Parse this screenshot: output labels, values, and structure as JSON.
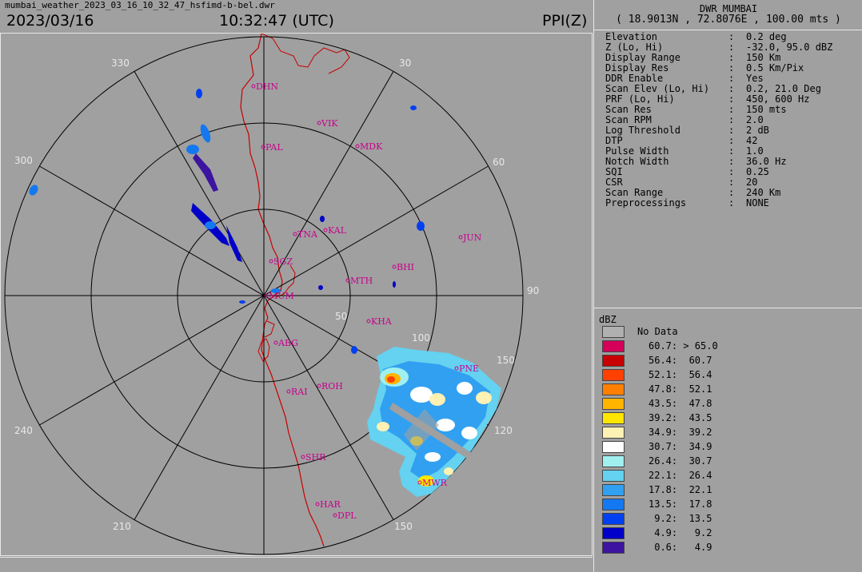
{
  "header": {
    "filename": "mumbai_weather_2023_03_16_10_32_47_hsfimd-b-bel.dwr",
    "date": "2023/03/16",
    "time": "10:32:47 (UTC)",
    "product": "PPI(Z)"
  },
  "station": {
    "name": "DWR MUMBAI",
    "coords": "( 18.9013N , 72.8076E , 100.00 mts )"
  },
  "info": [
    {
      "label": "Elevation",
      "value": "0.2 deg"
    },
    {
      "label": "Z (Lo, Hi)",
      "value": "-32.0, 95.0 dBZ"
    },
    {
      "label": "Display Range",
      "value": "150 Km"
    },
    {
      "label": "Display Res",
      "value": "0.5 Km/Pix"
    },
    {
      "label": "DDR Enable",
      "value": "Yes"
    },
    {
      "label": "Scan Elev (Lo, Hi)",
      "value": "0.2, 21.0 Deg"
    },
    {
      "label": "PRF (Lo, Hi)",
      "value": "450, 600 Hz"
    },
    {
      "label": "Scan Res",
      "value": "150 mts"
    },
    {
      "label": "Scan RPM",
      "value": "2.0"
    },
    {
      "label": "Log Threshold",
      "value": "2 dB"
    },
    {
      "label": "DTP",
      "value": "42"
    },
    {
      "label": "Pulse Width",
      "value": "1.0"
    },
    {
      "label": "Notch Width",
      "value": "36.0 Hz"
    },
    {
      "label": "SQI",
      "value": "0.25"
    },
    {
      "label": "CSR",
      "value": "20"
    },
    {
      "label": "Scan Range",
      "value": "240 Km"
    },
    {
      "label": "Preprocessings",
      "value": "NONE"
    }
  ],
  "info_separator": ":",
  "legend": {
    "title": "dBZ",
    "no_data_label": "No Data",
    "no_data_color": "#b0b0b0",
    "entries": [
      {
        "text": "60.7: > 65.0",
        "color": "#d4005a"
      },
      {
        "text": "56.4:  60.7",
        "color": "#c80000"
      },
      {
        "text": "52.1:  56.4",
        "color": "#ff4000"
      },
      {
        "text": "47.8:  52.1",
        "color": "#ff8000"
      },
      {
        "text": "43.5:  47.8",
        "color": "#ffb400"
      },
      {
        "text": "39.2:  43.5",
        "color": "#ffe600"
      },
      {
        "text": "34.9:  39.2",
        "color": "#fff0b4"
      },
      {
        "text": "30.7:  34.9",
        "color": "#ffffff"
      },
      {
        "text": "26.4:  30.7",
        "color": "#a0f0f0"
      },
      {
        "text": "22.1:  26.4",
        "color": "#64d2f0"
      },
      {
        "text": "17.8:  22.1",
        "color": "#32a0f0"
      },
      {
        "text": "13.5:  17.8",
        "color": "#1478f0"
      },
      {
        "text": " 9.2:  13.5",
        "color": "#0040f0"
      },
      {
        "text": " 4.9:   9.2",
        "color": "#0000c8"
      },
      {
        "text": " 0.6:   4.9",
        "color": "#3c14a0"
      }
    ]
  },
  "radar": {
    "azimuth_labels": [
      "30",
      "60",
      "90",
      "120",
      "150",
      "210",
      "240",
      "300",
      "330"
    ],
    "range_labels": [
      "50",
      "100",
      "150"
    ],
    "cities": [
      {
        "code": "DHN"
      },
      {
        "code": "VIK"
      },
      {
        "code": "PAL"
      },
      {
        "code": "MDK"
      },
      {
        "code": "TNA"
      },
      {
        "code": "KAL"
      },
      {
        "code": "JUN"
      },
      {
        "code": "SGZ"
      },
      {
        "code": "BHI"
      },
      {
        "code": "MTH"
      },
      {
        "code": "MUM"
      },
      {
        "code": "KHA"
      },
      {
        "code": "ABG"
      },
      {
        "code": "PNE"
      },
      {
        "code": "ROH"
      },
      {
        "code": "RAI"
      },
      {
        "code": "SHR"
      },
      {
        "code": "MWR"
      },
      {
        "code": "HAR"
      },
      {
        "code": "DPL"
      }
    ],
    "colors": {
      "grid": "#000000",
      "coast": "#c80000",
      "city": "#c8008c",
      "label": "#e8e8e8"
    }
  }
}
